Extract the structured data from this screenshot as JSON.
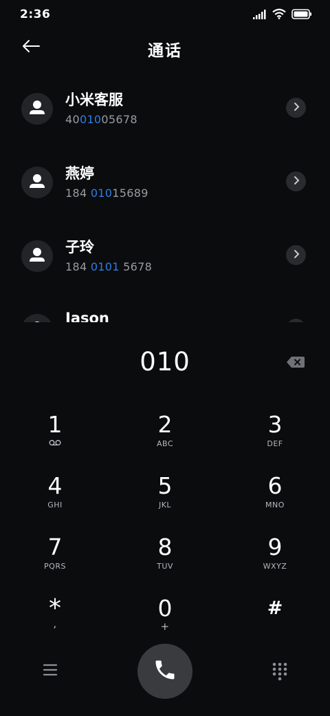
{
  "status_bar": {
    "time": "2:36",
    "icons": [
      "signal-icon",
      "wifi-icon",
      "battery-icon"
    ]
  },
  "header": {
    "title": "通话",
    "back_icon": "back-arrow-icon"
  },
  "contacts": [
    {
      "name": "小米客服",
      "number_parts": [
        "40",
        "010",
        "05678"
      ]
    },
    {
      "name": "燕婷",
      "number_parts": [
        "184 ",
        "010",
        "15689"
      ]
    },
    {
      "name": "子玲",
      "number_parts": [
        "184 ",
        "0101",
        " 5678"
      ]
    },
    {
      "name": "Jason",
      "number_parts": [
        "",
        "",
        ""
      ]
    }
  ],
  "dial": {
    "number": "010",
    "backspace_icon": "backspace-icon"
  },
  "keypad": [
    {
      "digit": "1",
      "letters": "",
      "sub_icon": "voicemail-icon"
    },
    {
      "digit": "2",
      "letters": "ABC"
    },
    {
      "digit": "3",
      "letters": "DEF"
    },
    {
      "digit": "4",
      "letters": "GHI"
    },
    {
      "digit": "5",
      "letters": "JKL"
    },
    {
      "digit": "6",
      "letters": "MNO"
    },
    {
      "digit": "7",
      "letters": "PQRS"
    },
    {
      "digit": "8",
      "letters": "TUV"
    },
    {
      "digit": "9",
      "letters": "WXYZ"
    },
    {
      "digit": "*",
      "letters": ","
    },
    {
      "digit": "0",
      "letters": "+"
    },
    {
      "digit": "#",
      "letters": ""
    }
  ],
  "bottom_bar": {
    "menu_icon": "menu-icon",
    "call_icon": "phone-icon",
    "keypad_icon": "dialpad-icon"
  },
  "colors": {
    "background": "#0b0c0e",
    "highlight": "#2e7ee6",
    "secondary_text": "#9a9ca1",
    "call_button": "#3a3b3f"
  }
}
